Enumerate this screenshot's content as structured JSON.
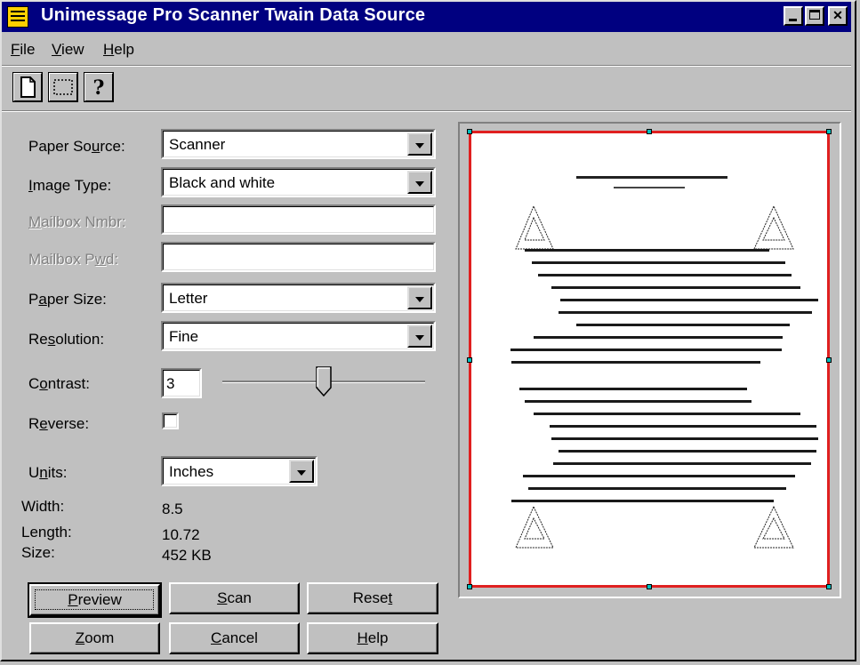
{
  "window": {
    "title": "Unimessage Pro Scanner Twain Data Source",
    "controls": [
      "minimize",
      "maximize",
      "close"
    ]
  },
  "menu": [
    {
      "label": "File",
      "mnemonic": "F"
    },
    {
      "label": "View",
      "mnemonic": "V"
    },
    {
      "label": "Help",
      "mnemonic": "H"
    }
  ],
  "toolbar": [
    {
      "icon": "new-page-icon"
    },
    {
      "icon": "select-area-icon"
    },
    {
      "icon": "help-question-icon"
    }
  ],
  "form": {
    "paper_source": {
      "label": "Paper Source:",
      "value": "Scanner"
    },
    "image_type": {
      "label": "Image Type:",
      "value": "Black and white"
    },
    "mailbox_nmbr": {
      "label": "Mailbox Nmbr:",
      "value": ""
    },
    "mailbox_pwd": {
      "label": "Mailbox Pwd:",
      "value": ""
    },
    "paper_size": {
      "label": "Paper Size:",
      "value": "Letter"
    },
    "resolution": {
      "label": "Resolution:",
      "value": "Fine"
    },
    "contrast": {
      "label": "Contrast:",
      "value": "3"
    },
    "reverse": {
      "label": "Reverse:",
      "checked": false
    },
    "units": {
      "label": "Units:",
      "value": "Inches"
    },
    "width": {
      "label": "Width:",
      "value": "8.5"
    },
    "length": {
      "label": "Length:",
      "value": "10.72"
    },
    "size": {
      "label": "Size:",
      "value": "452 KB"
    }
  },
  "buttons": {
    "preview": "Preview",
    "scan": "Scan",
    "reset": "Reset",
    "zoom": "Zoom",
    "cancel": "Cancel",
    "help": "Help"
  },
  "colors": {
    "titlebar": "#000080",
    "face": "#c0c0c0",
    "selection_border": "#e02020",
    "handle": "#00c0c0"
  }
}
